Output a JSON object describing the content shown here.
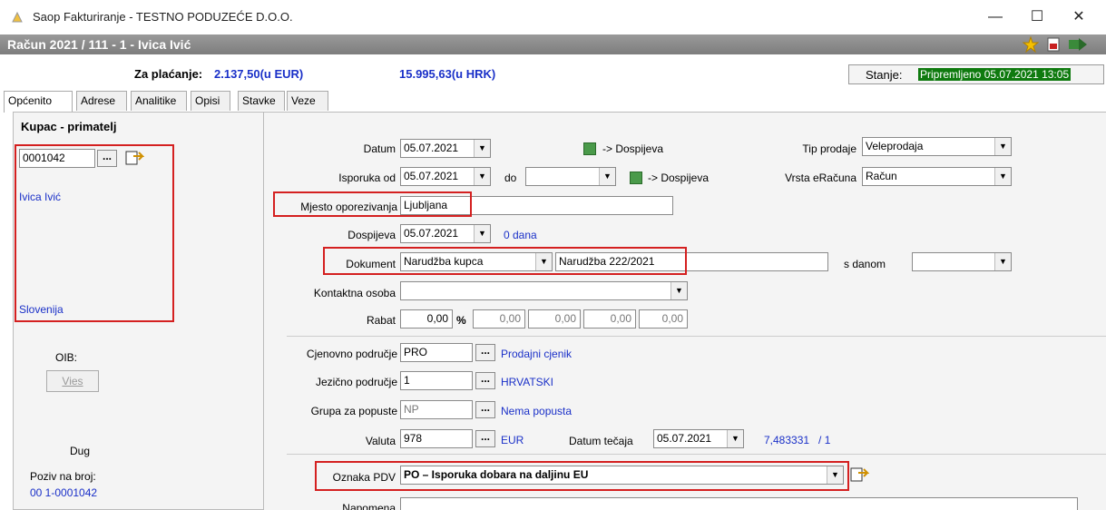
{
  "window": {
    "title": "Saop Fakturiranje - TESTNO PODUZEĆE D.O.O.",
    "minimize": "—",
    "maximize": "☐",
    "close": "✕"
  },
  "doc": {
    "title": "Račun 2021 / 111 - 1 - Ivica Ivić"
  },
  "summary": {
    "za_placanje_label": "Za plaćanje:",
    "za_placanje_value": "2.137,50(u EUR)",
    "hrk_value": "15.995,63(u HRK)",
    "stanje_label": "Stanje:",
    "stanje_value": "Pripremljeno 05.07.2021 13:05"
  },
  "tabs": [
    "Općenito",
    "Adrese",
    "Analitike",
    "Opisi",
    "Stavke",
    "Veze"
  ],
  "kupac": {
    "header": "Kupac - primatelj",
    "code": "0001042",
    "name": "Ivica Ivić",
    "country": "Slovenija",
    "oib_label": "OIB:",
    "vies_label": "Vies",
    "dug_label": "Dug",
    "poziv_label": "Poziv na broj:",
    "poziv_value": "00 1-0001042"
  },
  "form": {
    "datum_label": "Datum",
    "datum_value": "05.07.2021",
    "dospijeva_link": "-> Dospijeva",
    "isporuka_label": "Isporuka od",
    "isporuka_value": "05.07.2021",
    "do_label": "do",
    "do_value": "",
    "dospijeva_link2": "-> Dospijeva",
    "mjesto_label": "Mjesto oporezivanja",
    "mjesto_value": "Ljubljana",
    "dospijeva_label": "Dospijeva",
    "dospijeva_value": "05.07.2021",
    "dana_text": "0 dana",
    "dokument_label": "Dokument",
    "dokument_type": "Narudžba kupca",
    "dokument_value": "Narudžba 222/2021",
    "s_danom_label": "s danom",
    "s_danom_value": "",
    "kontakt_label": "Kontaktna osoba",
    "kontakt_value": "",
    "rabat_label": "Rabat",
    "rabat_value": "0,00",
    "rabat_pct": "%",
    "rabat_extra": [
      "0,00",
      "0,00",
      "0,00",
      "0,00"
    ],
    "tip_prodaje_label": "Tip prodaje",
    "tip_prodaje_value": "Veleprodaja",
    "vrsta_label": "Vrsta eRačuna",
    "vrsta_value": "Račun",
    "cjenovno_label": "Cjenovno područje",
    "cjenovno_value": "PRO",
    "cjenovno_link": "Prodajni cjenik",
    "jezicno_label": "Jezično područje",
    "jezicno_value": "1",
    "jezicno_link": "HRVATSKI",
    "grupa_label": "Grupa za popuste",
    "grupa_value": "NP",
    "grupa_link": "Nema popusta",
    "valuta_label": "Valuta",
    "valuta_value": "978",
    "valuta_link": "EUR",
    "datum_tecaja_label": "Datum tečaja",
    "datum_tecaja_value": "05.07.2021",
    "tecaj_text": "7,483331   / 1",
    "oznaka_label": "Oznaka PDV",
    "oznaka_value": "PO – Isporuka dobara na daljinu EU",
    "napomena_label": "Napomena",
    "napomena_value": ""
  },
  "colors": {
    "accent_red": "#d42020",
    "link_blue": "#1a30c8",
    "status_green": "#0f7a0f"
  }
}
